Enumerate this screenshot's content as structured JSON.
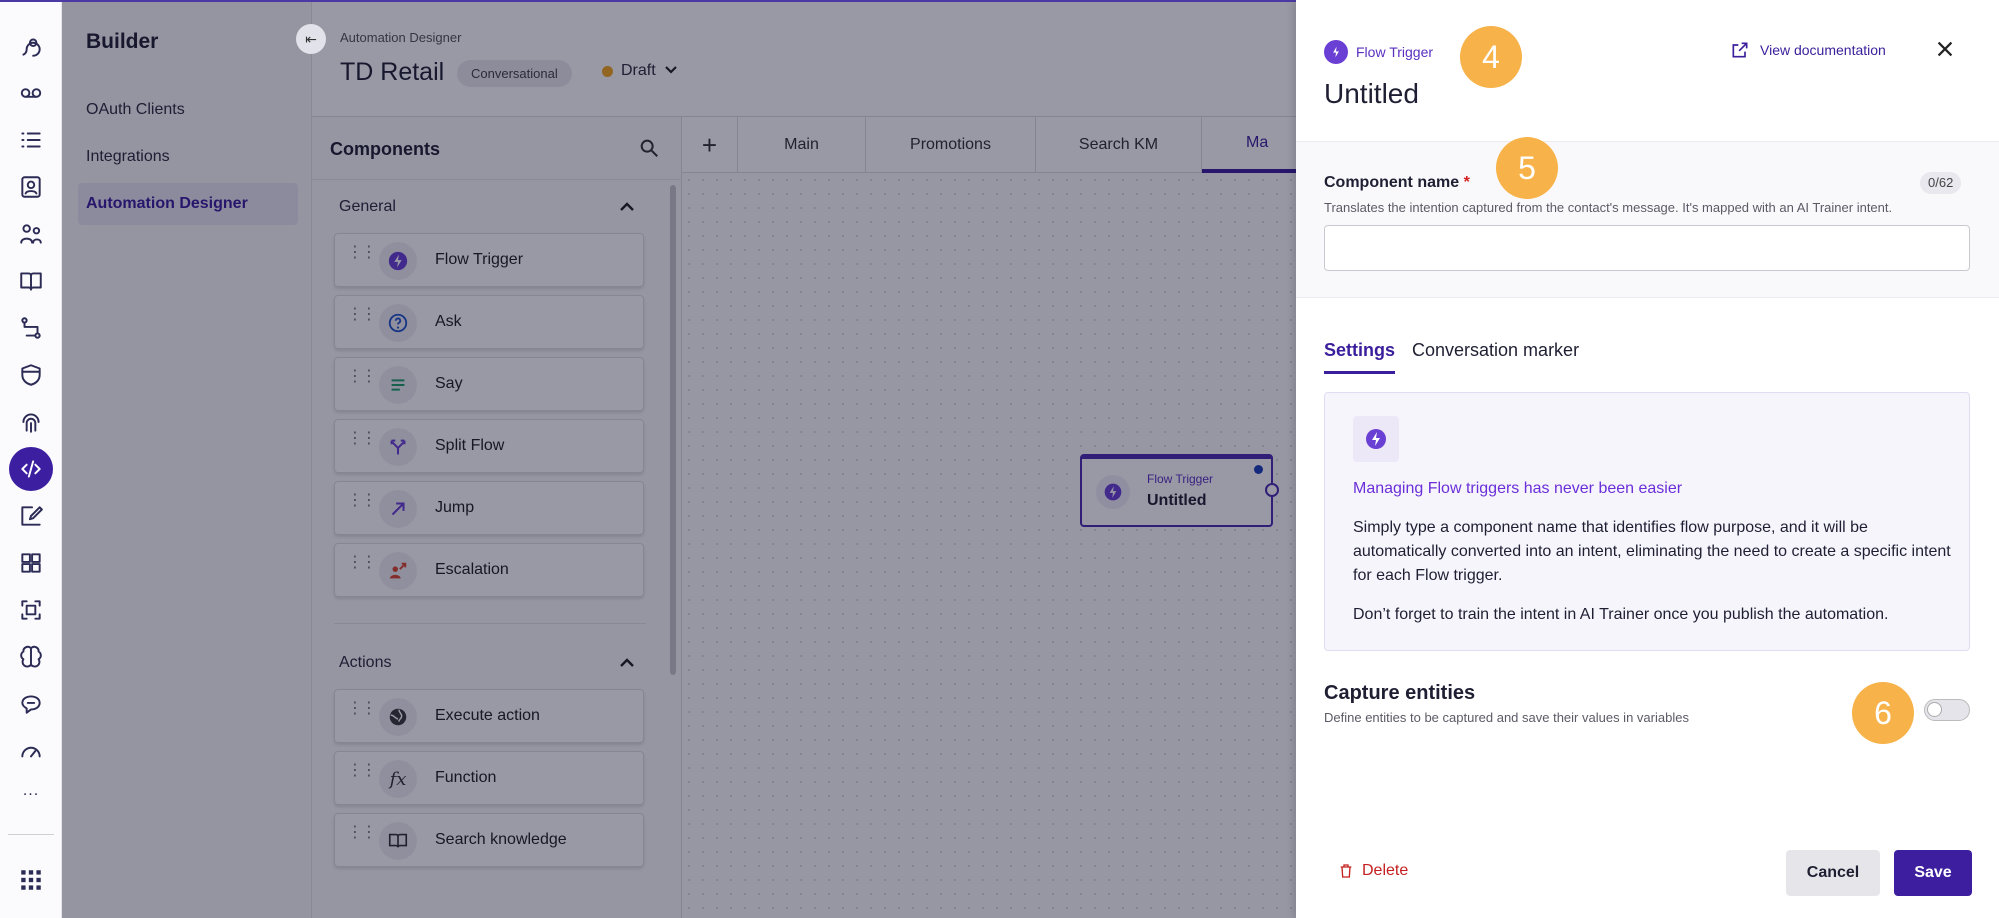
{
  "colors": {
    "accent": "#3b1e9c",
    "callout": "#f7b34a",
    "danger": "#c51f1f",
    "draft": "#f3a51a"
  },
  "rail": {
    "icons": [
      "dialog-icon",
      "voicemail-icon",
      "list-icon",
      "contact-card-icon",
      "people-icon",
      "book-icon",
      "flow-icon",
      "shield-icon",
      "fingerprint-icon",
      "code-icon",
      "edit-icon",
      "dashboard-icon",
      "frame-icon",
      "brain-icon",
      "chat-icon",
      "gauge-icon"
    ],
    "more": "...",
    "apps_icon": "grid-icon"
  },
  "builder": {
    "title": "Builder",
    "items": [
      {
        "label": "OAuth Clients"
      },
      {
        "label": "Integrations"
      },
      {
        "label": "Automation Designer"
      }
    ]
  },
  "header": {
    "breadcrumb": "Automation Designer",
    "title": "TD Retail",
    "badge": "Conversational",
    "status": "Draft"
  },
  "components": {
    "title": "Components",
    "groups": [
      {
        "label": "General",
        "items": [
          {
            "label": "Flow Trigger",
            "icon": "bolt-icon"
          },
          {
            "label": "Ask",
            "icon": "question-icon"
          },
          {
            "label": "Say",
            "icon": "lines-icon"
          },
          {
            "label": "Split Flow",
            "icon": "split-icon"
          },
          {
            "label": "Jump",
            "icon": "arrow-icon"
          },
          {
            "label": "Escalation",
            "icon": "person-arrow-icon"
          }
        ]
      },
      {
        "label": "Actions",
        "items": [
          {
            "label": "Execute action",
            "icon": "globe-icon"
          },
          {
            "label": "Function",
            "icon": "fx-icon"
          },
          {
            "label": "Search knowledge",
            "icon": "book-icon"
          }
        ]
      }
    ]
  },
  "tabs": {
    "plus": "+",
    "items": [
      "Main",
      "Promotions",
      "Search KM",
      "Ma"
    ]
  },
  "node": {
    "type": "Flow Trigger",
    "name": "Untitled"
  },
  "panel": {
    "type_label": "Flow Trigger",
    "title": "Untitled",
    "doc_link": "View documentation",
    "callouts": [
      "4",
      "5",
      "6"
    ],
    "field": {
      "label": "Component name",
      "required_mark": "*",
      "counter": "0/62",
      "help": "Translates the intention captured from the contact's message. It's mapped with an AI Trainer intent.",
      "value": ""
    },
    "tabs": [
      "Settings",
      "Conversation marker"
    ],
    "info": {
      "heading": "Managing Flow triggers has never been easier",
      "body": "Simply type a component name that identifies flow purpose, and it will be automatically converted into an intent, eliminating the need to create a specific intent for each Flow trigger.",
      "body2": "Don’t forget to train the intent in AI Trainer once you publish the automation."
    },
    "capture": {
      "title": "Capture entities",
      "help": "Define entities to be captured and save their values in variables",
      "enabled": false
    },
    "delete_label": "Delete",
    "cancel_label": "Cancel",
    "save_label": "Save"
  }
}
